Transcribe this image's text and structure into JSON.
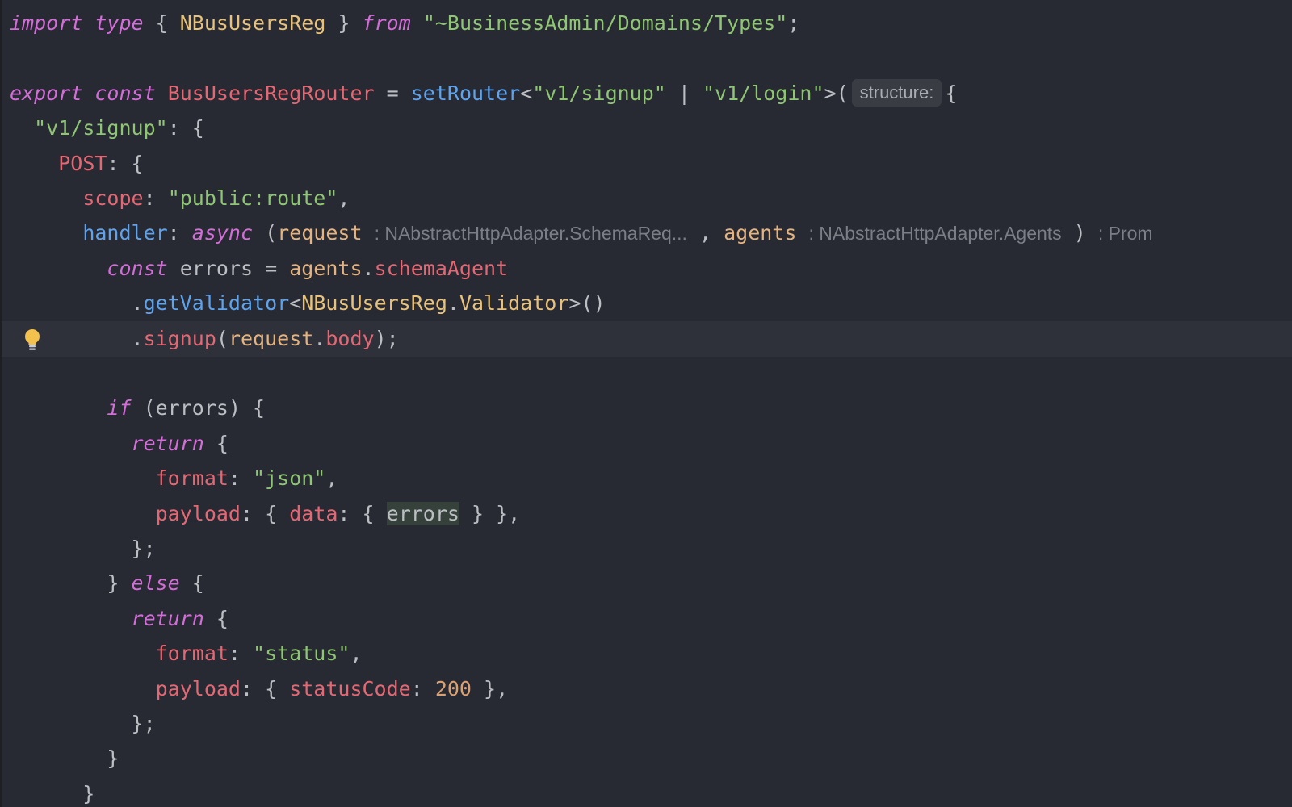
{
  "editor": {
    "lines": [
      {
        "tokens": [
          [
            "kw",
            "import"
          ],
          [
            "plain",
            " "
          ],
          [
            "kw",
            "type"
          ],
          [
            "plain",
            " { "
          ],
          [
            "ty",
            "NBusUsersReg"
          ],
          [
            "plain",
            " } "
          ],
          [
            "kw",
            "from"
          ],
          [
            "plain",
            " "
          ],
          [
            "str",
            "\"~BusinessAdmin/Domains/Types\""
          ],
          [
            "plain",
            ";"
          ]
        ]
      },
      {
        "tokens": []
      },
      {
        "tokens": [
          [
            "kw",
            "export"
          ],
          [
            "plain",
            " "
          ],
          [
            "kw",
            "const"
          ],
          [
            "plain",
            " "
          ],
          [
            "prop",
            "BusUsersRegRouter"
          ],
          [
            "plain",
            " = "
          ],
          [
            "fn",
            "setRouter"
          ],
          [
            "plain",
            "<"
          ],
          [
            "str",
            "\"v1/signup\""
          ],
          [
            "plain",
            " | "
          ],
          [
            "str",
            "\"v1/login\""
          ],
          [
            "plain",
            ">("
          ],
          [
            "hintbox",
            "structure:"
          ],
          [
            "plain",
            "{"
          ]
        ]
      },
      {
        "tokens": [
          [
            "plain",
            "  "
          ],
          [
            "str",
            "\"v1/signup\""
          ],
          [
            "plain",
            ": {"
          ]
        ]
      },
      {
        "tokens": [
          [
            "plain",
            "    "
          ],
          [
            "prop",
            "POST"
          ],
          [
            "plain",
            ": {"
          ]
        ]
      },
      {
        "tokens": [
          [
            "plain",
            "      "
          ],
          [
            "prop",
            "scope"
          ],
          [
            "plain",
            ": "
          ],
          [
            "str",
            "\"public:route\""
          ],
          [
            "plain",
            ","
          ]
        ]
      },
      {
        "tokens": [
          [
            "plain",
            "      "
          ],
          [
            "fn",
            "handler"
          ],
          [
            "plain",
            ": "
          ],
          [
            "kw",
            "async"
          ],
          [
            "plain",
            " ("
          ],
          [
            "param",
            "request"
          ],
          [
            "plain",
            " "
          ],
          [
            "hint",
            ": NAbstractHttpAdapter.SchemaReq..."
          ],
          [
            "plain",
            " , "
          ],
          [
            "param",
            "agents"
          ],
          [
            "plain",
            " "
          ],
          [
            "hint",
            ": NAbstractHttpAdapter.Agents"
          ],
          [
            "plain",
            " ) "
          ],
          [
            "hint",
            ": Prom"
          ]
        ]
      },
      {
        "tokens": [
          [
            "plain",
            "        "
          ],
          [
            "kw",
            "const"
          ],
          [
            "plain",
            " errors = "
          ],
          [
            "param",
            "agents"
          ],
          [
            "plain",
            "."
          ],
          [
            "prop",
            "schemaAgent"
          ]
        ]
      },
      {
        "tokens": [
          [
            "plain",
            "          ."
          ],
          [
            "fn",
            "getValidator"
          ],
          [
            "plain",
            "<"
          ],
          [
            "ty",
            "NBusUsersReg"
          ],
          [
            "plain",
            "."
          ],
          [
            "ty",
            "Validator"
          ],
          [
            "plain",
            ">()"
          ]
        ]
      },
      {
        "tokens": [
          [
            "plain",
            "          ."
          ],
          [
            "prop",
            "signup"
          ],
          [
            "plain",
            "("
          ],
          [
            "param",
            "request"
          ],
          [
            "plain",
            "."
          ],
          [
            "prop",
            "body"
          ],
          [
            "plain",
            ");"
          ]
        ]
      },
      {
        "tokens": []
      },
      {
        "tokens": [
          [
            "plain",
            "        "
          ],
          [
            "kw",
            "if"
          ],
          [
            "plain",
            " (errors) {"
          ]
        ]
      },
      {
        "tokens": [
          [
            "plain",
            "          "
          ],
          [
            "kw",
            "return"
          ],
          [
            "plain",
            " {"
          ]
        ]
      },
      {
        "tokens": [
          [
            "plain",
            "            "
          ],
          [
            "prop",
            "format"
          ],
          [
            "plain",
            ": "
          ],
          [
            "str",
            "\"json\""
          ],
          [
            "plain",
            ","
          ]
        ]
      },
      {
        "tokens": [
          [
            "plain",
            "            "
          ],
          [
            "prop",
            "payload"
          ],
          [
            "plain",
            ": { "
          ],
          [
            "prop",
            "data"
          ],
          [
            "plain",
            ": { "
          ],
          [
            "hl",
            "errors"
          ],
          [
            "plain",
            " } },"
          ]
        ]
      },
      {
        "tokens": [
          [
            "plain",
            "          };"
          ]
        ]
      },
      {
        "tokens": [
          [
            "plain",
            "        } "
          ],
          [
            "kw",
            "else"
          ],
          [
            "plain",
            " {"
          ]
        ]
      },
      {
        "tokens": [
          [
            "plain",
            "          "
          ],
          [
            "kw",
            "return"
          ],
          [
            "plain",
            " {"
          ]
        ]
      },
      {
        "tokens": [
          [
            "plain",
            "            "
          ],
          [
            "prop",
            "format"
          ],
          [
            "plain",
            ": "
          ],
          [
            "str",
            "\"status\""
          ],
          [
            "plain",
            ","
          ]
        ]
      },
      {
        "tokens": [
          [
            "plain",
            "            "
          ],
          [
            "prop",
            "payload"
          ],
          [
            "plain",
            ": { "
          ],
          [
            "prop",
            "statusCode"
          ],
          [
            "plain",
            ": "
          ],
          [
            "num",
            "200"
          ],
          [
            "plain",
            " },"
          ]
        ]
      },
      {
        "tokens": [
          [
            "plain",
            "          };"
          ]
        ]
      },
      {
        "tokens": [
          [
            "plain",
            "        }"
          ]
        ]
      },
      {
        "tokens": [
          [
            "plain",
            "      }"
          ]
        ]
      }
    ],
    "current_line": 9,
    "gutter_icon": "lightbulb-icon"
  }
}
